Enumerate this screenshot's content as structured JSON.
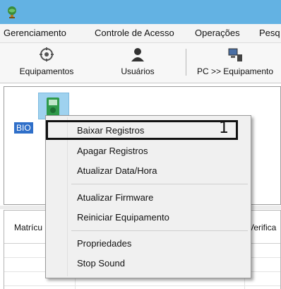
{
  "app": {
    "icon": "globe-app-icon"
  },
  "menu": [
    "Gerenciamento",
    "Controle de Acesso",
    "Operações",
    "Pesq"
  ],
  "toolbar": {
    "items": [
      {
        "label": "Equipamentos",
        "icon": "devices-icon"
      },
      {
        "label": "Usuários",
        "icon": "users-icon"
      },
      {
        "label": "PC >> Equipamento",
        "icon": "pc-to-device-icon"
      }
    ]
  },
  "device": {
    "label": "BIO"
  },
  "grid": {
    "columns": [
      "Matrícu",
      "Verifica"
    ]
  },
  "context_menu": {
    "items": [
      "Baixar Registros",
      "Apagar Registros",
      "Atualizar Data/Hora",
      "Atualizar Firmware",
      "Reiniciar Equipamento",
      "Propriedades",
      "Stop Sound"
    ],
    "highlight_number": "1"
  },
  "colors": {
    "titlebar": "#63b2e3",
    "selection": "#2f6fc9"
  }
}
